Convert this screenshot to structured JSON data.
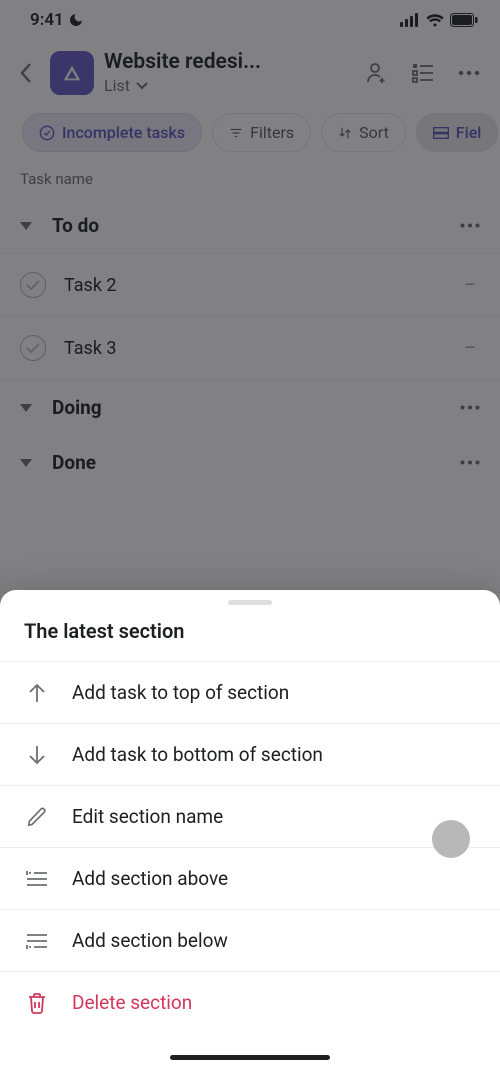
{
  "status": {
    "time": "9:41"
  },
  "header": {
    "project_title": "Website redesi...",
    "view_label": "List"
  },
  "filters": {
    "incomplete": "Incomplete tasks",
    "filters": "Filters",
    "sort": "Sort",
    "fields": "Fiel"
  },
  "columns": {
    "task_name": "Task name"
  },
  "sections": {
    "todo": "To do",
    "doing": "Doing",
    "done": "Done"
  },
  "tasks": {
    "t2": "Task 2",
    "t3": "Task 3",
    "dash": "–"
  },
  "sheet": {
    "title": "The latest section",
    "add_top": "Add task to top of section",
    "add_bottom": "Add task to bottom of section",
    "edit": "Edit section name",
    "add_above": "Add section above",
    "add_below": "Add section below",
    "delete": "Delete section"
  }
}
